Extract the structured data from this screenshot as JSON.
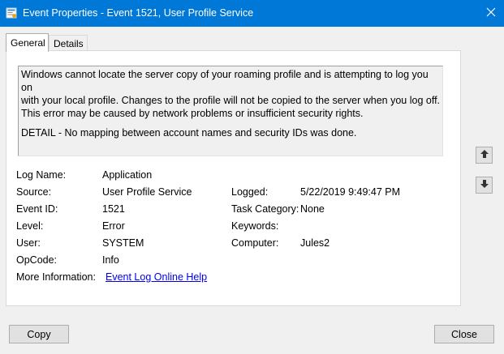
{
  "window": {
    "title": "Event Properties - Event 1521, User Profile Service",
    "title_bar_color": "#0078d7",
    "icons": {
      "app": "event-viewer-icon",
      "close": "close-icon"
    }
  },
  "tabs": [
    {
      "label": "General",
      "active": true
    },
    {
      "label": "Details",
      "active": false
    }
  ],
  "description": {
    "text": "Windows cannot locate the server copy of your roaming profile and is attempting to log you on\nwith your local profile. Changes to the profile will not be copied to the server when you log off.\nThis error may be caused by network problems or insufficient security rights.",
    "detail": " DETAIL - No mapping between account names and security IDs was done."
  },
  "fields": {
    "log_name": {
      "label": "Log Name:",
      "value": "Application"
    },
    "source": {
      "label": "Source:",
      "value": "User Profile Service"
    },
    "logged": {
      "label": "Logged:",
      "value": "5/22/2019 9:49:47 PM"
    },
    "event_id": {
      "label": "Event ID:",
      "value": "1521"
    },
    "task_category": {
      "label": "Task Category:",
      "value": "None"
    },
    "level": {
      "label": "Level:",
      "value": "Error"
    },
    "keywords": {
      "label": "Keywords:",
      "value": ""
    },
    "user": {
      "label": "User:",
      "value": "SYSTEM"
    },
    "computer": {
      "label": "Computer:",
      "value": "Jules2"
    },
    "opcode": {
      "label": "OpCode:",
      "value": "Info"
    },
    "more_info": {
      "label": "More Information:",
      "link": "Event Log Online Help"
    }
  },
  "nav": {
    "up_icon": "arrow-up-icon",
    "down_icon": "arrow-down-icon"
  },
  "buttons": {
    "copy": "Copy",
    "close": "Close"
  }
}
